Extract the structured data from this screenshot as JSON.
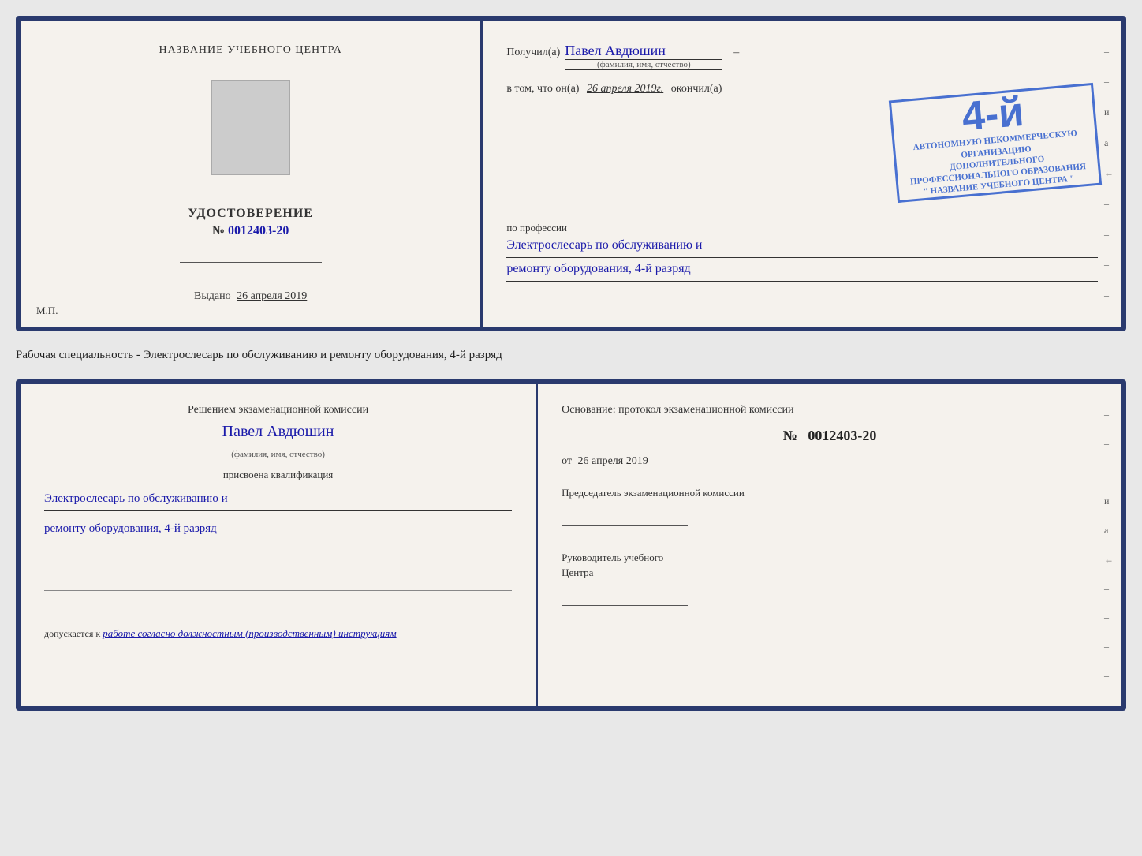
{
  "page": {
    "background": "#e8e8e8"
  },
  "top_document": {
    "left_panel": {
      "title": "НАЗВАНИЕ УЧЕБНОГО ЦЕНТРА",
      "cert_heading": "УДОСТОВЕРЕНИЕ",
      "cert_number_prefix": "№",
      "cert_number": "0012403-20",
      "issued_label": "Выдано",
      "issued_date": "26 апреля 2019",
      "mp_label": "М.П."
    },
    "right_panel": {
      "recipient_prefix": "Получил(а)",
      "recipient_name": "Павел Авдюшин",
      "recipient_field_label": "(фамилия, имя, отчество)",
      "vtom_prefix": "в том, что он(а)",
      "vtom_date": "26 апреля 2019г.",
      "okonchil": "окончил(а)",
      "stamp_grade": "4-й",
      "stamp_line1": "АВТОНОМНУЮ НЕКОММЕРЧЕСКУЮ ОРГАНИЗАЦИЮ",
      "stamp_line2": "ДОПОЛНИТЕЛЬНОГО ПРОФЕССИОНАЛЬНОГО ОБРАЗОВАНИЯ",
      "stamp_line3": "\" НАЗВАНИЕ УЧЕБНОГО ЦЕНТРА \"",
      "profession_label": "по профессии",
      "profession_value_line1": "Электрослесарь по обслуживанию и",
      "profession_value_line2": "ремонту оборудования, 4-й разряд"
    },
    "right_dashes": [
      "-",
      "-",
      "и",
      "а",
      "←",
      "-",
      "-",
      "-",
      "-"
    ]
  },
  "subtitle": {
    "text": "Рабочая специальность - Электрослесарь по обслуживанию и ремонту оборудования, 4-й разряд"
  },
  "bottom_document": {
    "left_panel": {
      "decision_title": "Решением экзаменационной комиссии",
      "person_name": "Павел Авдюшин",
      "person_label": "(фамилия, имя, отчество)",
      "assigned_text": "присвоена квалификация",
      "qualification_line1": "Электрослесарь по обслуживанию и",
      "qualification_line2": "ремонту оборудования, 4-й разряд",
      "dopusk_prefix": "допускается к",
      "dopusk_text": "работе согласно должностным (производственным) инструкциям"
    },
    "right_panel": {
      "osnov_text": "Основание: протокол экзаменационной комиссии",
      "number_prefix": "№",
      "number_value": "0012403-20",
      "date_prefix": "от",
      "date_value": "26 апреля 2019",
      "chairman_title": "Председатель экзаменационной комиссии",
      "head_title_line1": "Руководитель учебного",
      "head_title_line2": "Центра"
    },
    "right_dashes": [
      "-",
      "-",
      "-",
      "и",
      "а",
      "←",
      "-",
      "-",
      "-",
      "-"
    ]
  }
}
